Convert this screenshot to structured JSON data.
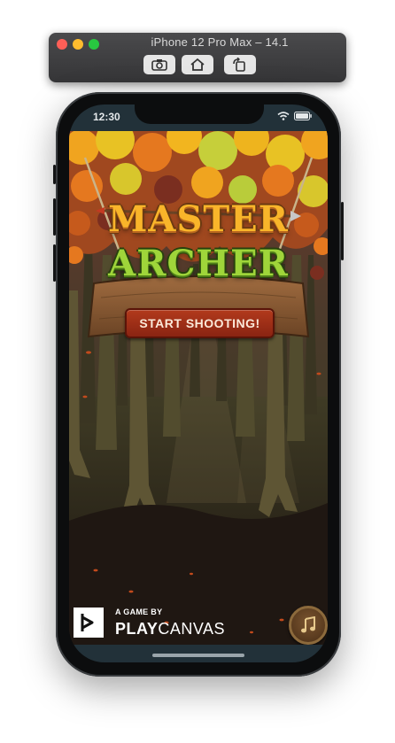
{
  "simulator": {
    "title": "iPhone 12 Pro Max – 14.1",
    "buttons": {
      "screenshot_icon": "camera-icon",
      "home_icon": "home-icon",
      "rotate_icon": "rotate-icon"
    }
  },
  "status_bar": {
    "time": "12:30",
    "icons": [
      "wifi-icon",
      "battery-icon"
    ]
  },
  "game": {
    "title_line1": "MASTER",
    "title_line2": "ARCHER",
    "start_button": "START SHOOTING!",
    "credit": {
      "byline": "A GAME BY",
      "brand_bold": "PLAY",
      "brand_light": "CANVAS"
    },
    "music_icon": "music-note-icon"
  },
  "colors": {
    "title_gold": "#f9b52a",
    "title_green": "#9fd53a",
    "button_red": "#9b2c15",
    "sign_wood": "#8a5a34"
  }
}
